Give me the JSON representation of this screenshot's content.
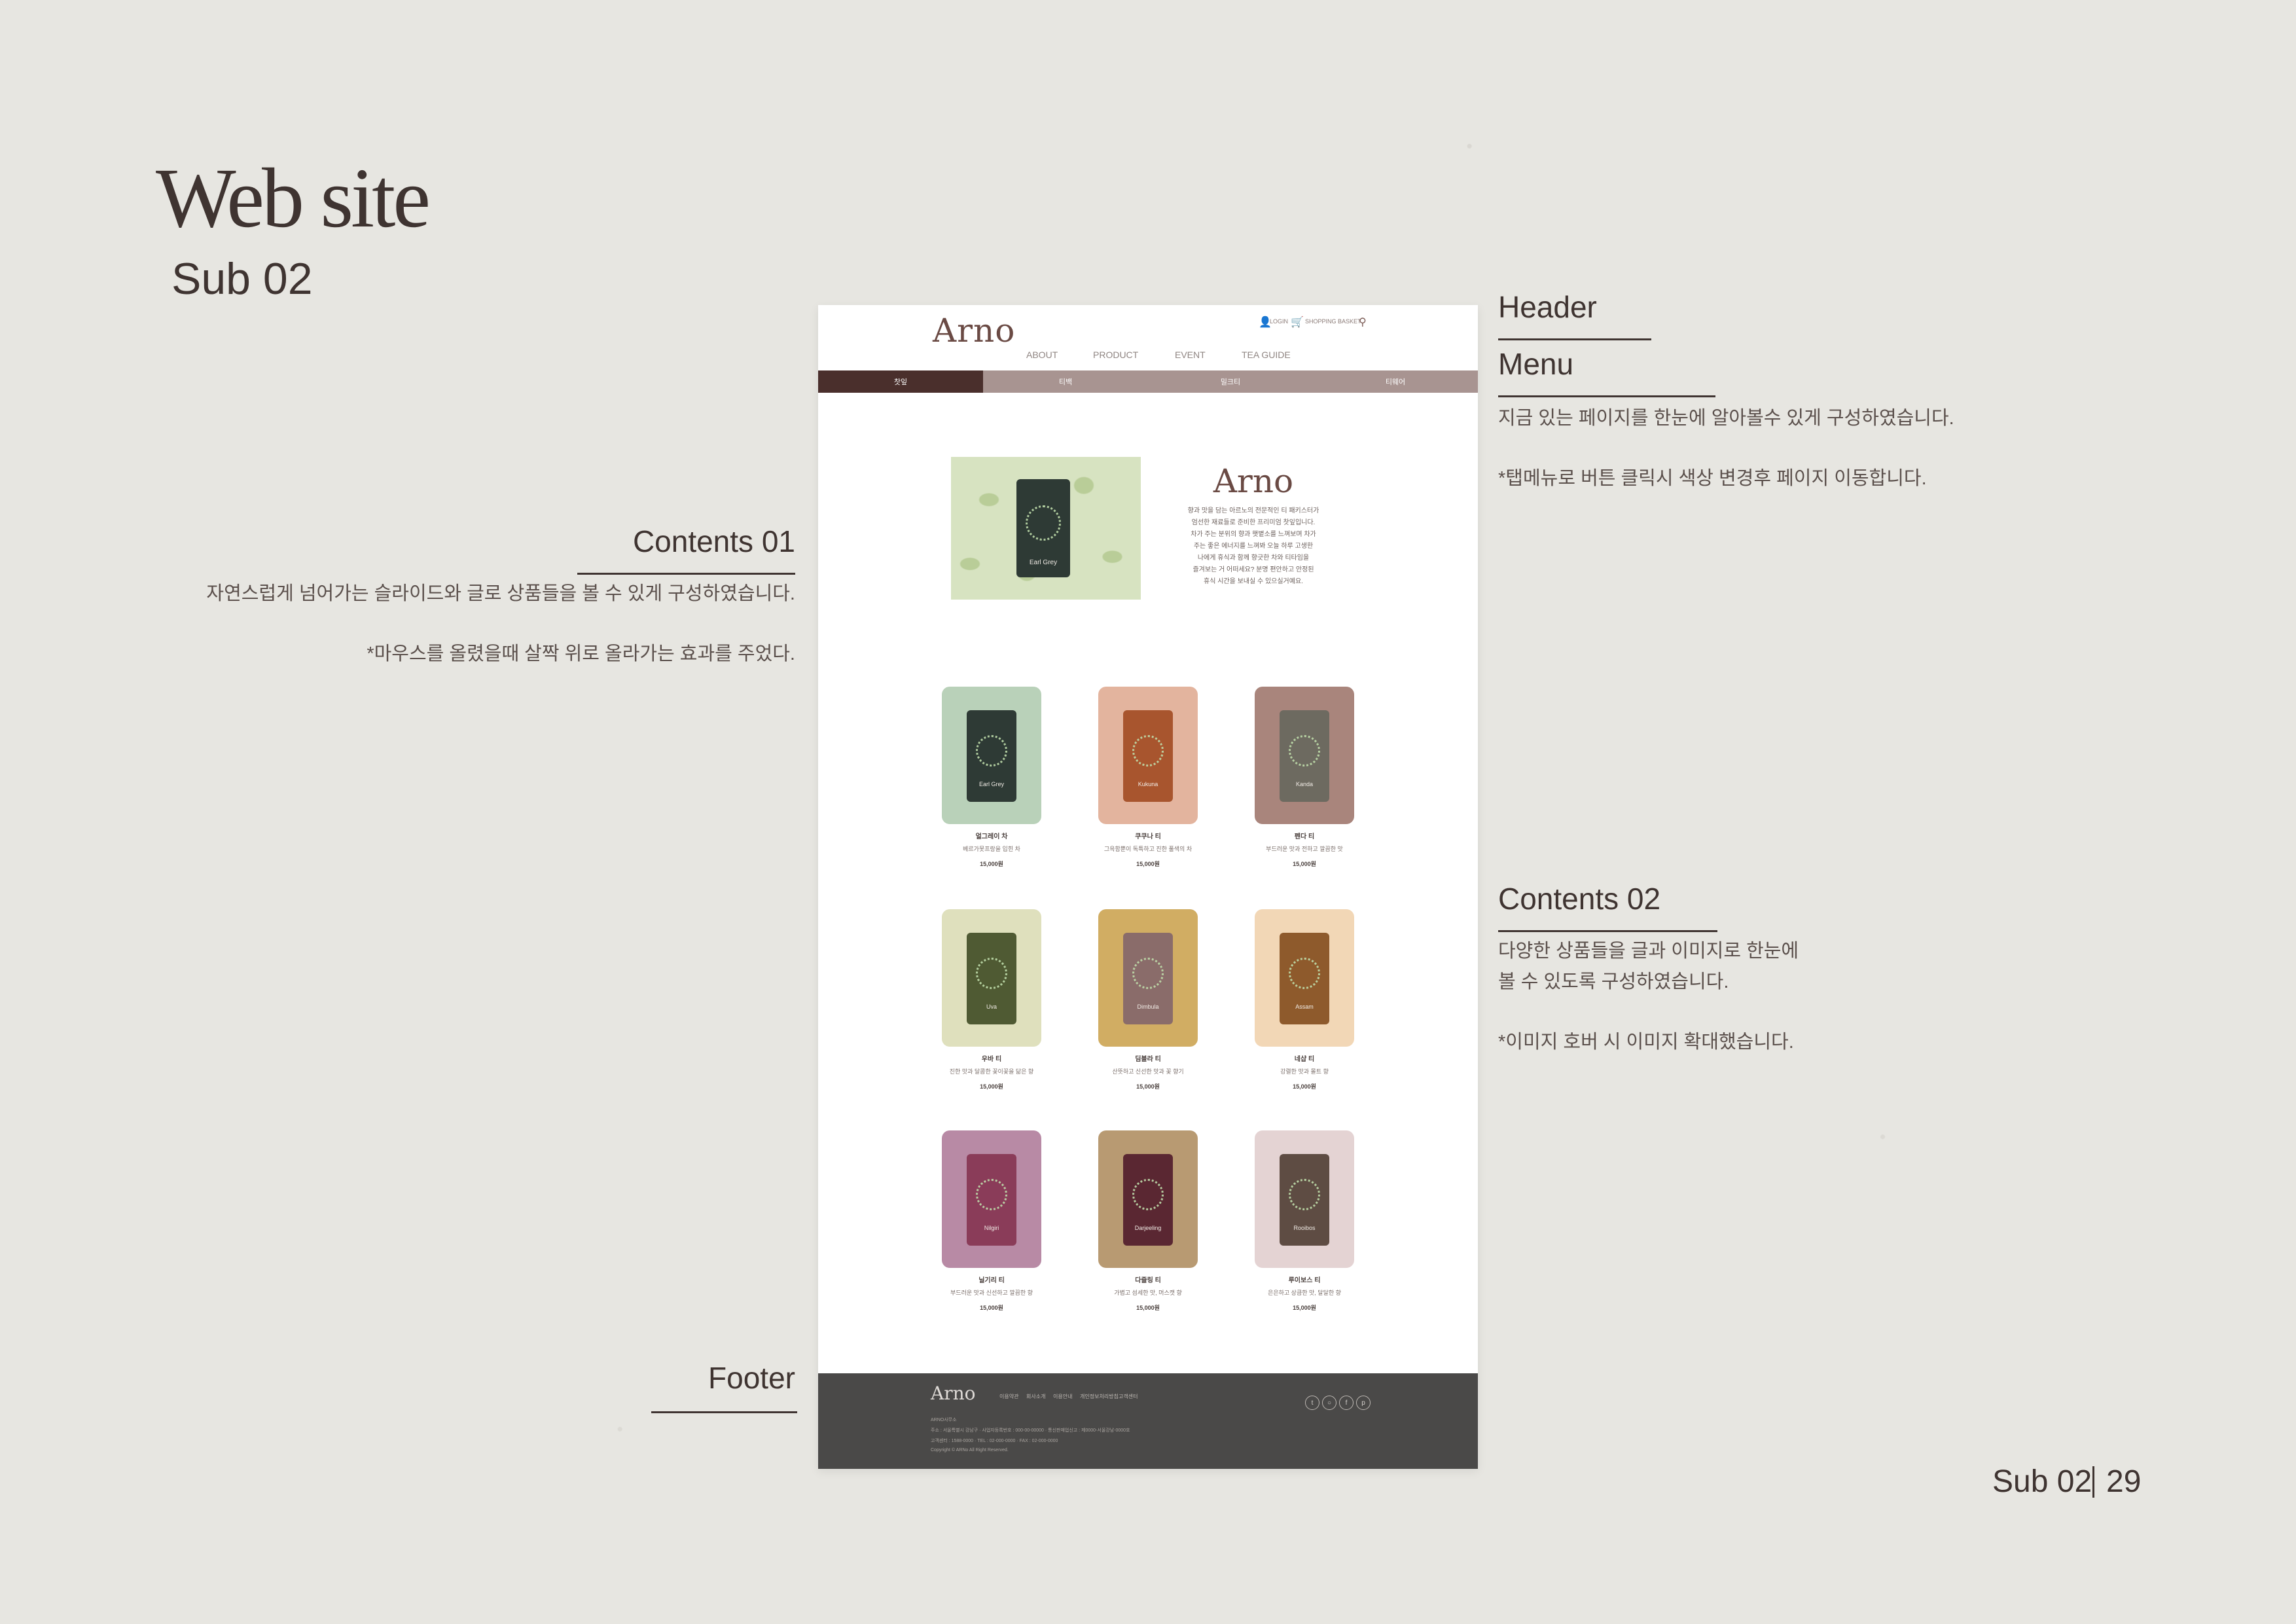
{
  "slide": {
    "title": "Web site",
    "subtitle": "Sub 02",
    "page_section": "Sub 02",
    "page_number": "29"
  },
  "annotations": {
    "header": "Header",
    "menu": {
      "heading": "Menu",
      "line1": "지금 있는 페이지를 한눈에 알아볼수 있게 구성하였습니다.",
      "line2": "*탭메뉴로 버튼 클릭시 색상 변경후 페이지 이동합니다."
    },
    "contents01": {
      "heading": "Contents 01",
      "line1": "자연스럽게 넘어가는 슬라이드와 글로 상품들을 볼 수 있게 구성하였습니다.",
      "line2": "*마우스를 올렸을때 살짝 위로 올라가는 효과를 주었다."
    },
    "contents02": {
      "heading": "Contents 02",
      "line1": "다양한 상품들을 글과 이미지로 한눈에",
      "line2": "볼 수 있도록 구성하였습니다.",
      "line3": "*이미지 호버 시 이미지 확대했습니다."
    },
    "footer": "Footer"
  },
  "site": {
    "logo": "Arno",
    "util": {
      "login": "LOGIN",
      "basket": "SHOPPING BASKET",
      "user_icon": "user-icon",
      "cart_icon": "cart-icon",
      "search_icon": "search-icon"
    },
    "nav": [
      "ABOUT",
      "PRODUCT",
      "EVENT",
      "TEA GUIDE"
    ],
    "tabs": [
      "찻잎",
      "티백",
      "밀크티",
      "티웨어"
    ],
    "colors": {
      "active_tab": "#4a2f2c",
      "tabbar": "#a89491",
      "footer": "#4a4948"
    },
    "hero": {
      "logo": "Arno",
      "product_label": "Earl Grey",
      "text": [
        "향과 맛을 담는 아르노의 전문적인 티 패키스터가",
        "엄선한 재료들로 준비한 프리미엄 찻잎입니다.",
        "차가 주는 분위의 향과 햇볕소를 느껴보며 차가",
        "주는 좋은 에너지를 느껴봐 오늘 하루 고생한",
        "나에게 휴식과 함께 향긋한 차와 티타임을",
        "즐겨보는 거 어떠세요? 분명 편안하고 안정된",
        "휴식 시간을 보내실 수 있으실거예요."
      ]
    },
    "products": [
      {
        "name": "얼그레이 차",
        "desc": "베르가못프랑을 입힌 차",
        "price": "15,000원",
        "label": "Earl Grey",
        "bg": "#b9d1b9",
        "can": "#2e3a35"
      },
      {
        "name": "쿠쿠나 티",
        "desc": "그윽함뿐이 독특하고 진한 풀색의 차",
        "price": "15,000원",
        "label": "Kukuna",
        "bg": "#e3b49e",
        "can": "#a8552e"
      },
      {
        "name": "펜다 티",
        "desc": "부드러운 맛과 전하고 깔끔한 맛",
        "price": "15,000원",
        "label": "Kanda",
        "bg": "#a9857c",
        "can": "#6d6a60"
      },
      {
        "name": "우바 티",
        "desc": "진한 맛과 달콤한 꽃이꽃을 닮은 향",
        "price": "15,000원",
        "label": "Uva",
        "bg": "#dfe0bd",
        "can": "#4f5a33"
      },
      {
        "name": "딤블라 티",
        "desc": "산뜻하고 신선한 맛과 꽃 향기",
        "price": "15,000원",
        "label": "Dimbula",
        "bg": "#d1ad63",
        "can": "#8a6c6a"
      },
      {
        "name": "네샵 티",
        "desc": "강렬한 맛과 몰트 향",
        "price": "15,000원",
        "label": "Assam",
        "bg": "#f2d7b6",
        "can": "#8e5a2c"
      },
      {
        "name": "닐기리 티",
        "desc": "부드러운 맛과 신선하고 깔끔한 향",
        "price": "15,000원",
        "label": "Nilgiri",
        "bg": "#b88aa5",
        "can": "#8a3c59"
      },
      {
        "name": "다즐링 티",
        "desc": "가볍고 섬세한 맛, 머스캣 향",
        "price": "15,000원",
        "label": "Darjeeling",
        "bg": "#b89a72",
        "can": "#5a2732"
      },
      {
        "name": "루이보스 티",
        "desc": "은은하고 상큼한 맛, 달달한 향",
        "price": "15,000원",
        "label": "Rooibos",
        "bg": "#e4d3d3",
        "can": "#5e4c43"
      }
    ],
    "footer": {
      "logo": "Arno",
      "links": [
        "이용약관",
        "회사소개",
        "이용안내",
        "개인정보처리방침",
        "고객센터"
      ],
      "lines": [
        "ARNO사무소",
        "주소 : 서울특별시 강남구 · 사업자등록번호 : 000-00-00000 · 통신판매업신고 : 제0000-서울강남-0000호",
        "고객센터 : 1588-0000 · TEL : 02-000-0000 · FAX : 02-000-0000",
        "Copyright © ARNo All Right Reserved."
      ],
      "social": [
        "twitter-icon",
        "instagram-icon",
        "facebook-icon",
        "pinterest-icon"
      ]
    }
  }
}
